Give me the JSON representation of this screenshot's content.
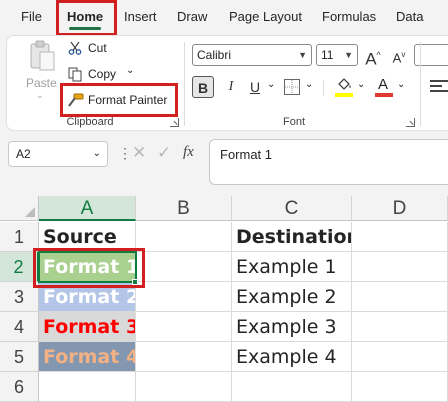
{
  "menu": {
    "tabs": [
      "File",
      "Home",
      "Insert",
      "Draw",
      "Page Layout",
      "Formulas",
      "Data"
    ],
    "active_tab": "Home"
  },
  "ribbon": {
    "clipboard": {
      "paste_label": "Paste",
      "cut_label": "Cut",
      "copy_label": "Copy",
      "format_painter_label": "Format Painter",
      "group_label": "Clipboard"
    },
    "font": {
      "font_name": "Calibri",
      "font_size": "11",
      "grow_label": "A",
      "shrink_label": "A",
      "bold_label": "B",
      "italic_label": "I",
      "underline_label": "U",
      "font_color_label": "A",
      "group_label": "Font",
      "fill_color": "#ffff00",
      "font_color": "#e03b2f"
    }
  },
  "formula_bar": {
    "cell_ref": "A2",
    "fx_label": "fx",
    "content": "Format 1"
  },
  "sheet": {
    "columns": [
      "A",
      "B",
      "C",
      "D"
    ],
    "rows": [
      "1",
      "2",
      "3",
      "4",
      "5",
      "6"
    ],
    "selected_cell": "A2",
    "cells": {
      "A1": "Source",
      "C1": "Destination",
      "A2": "Format 1",
      "C2": "Example 1",
      "A3": "Format 2",
      "C3": "Example 2",
      "A4": "Format 3",
      "C4": "Example 3",
      "A5": "Format 4",
      "C5": "Example 4"
    },
    "styles": {
      "A2": {
        "fill": "#a9d08e",
        "color": "#ffffff"
      },
      "A3": {
        "fill": "#b4c6e7",
        "color": "#ffffff"
      },
      "A4": {
        "fill": "#d9d9d9",
        "color": "#ff0000"
      },
      "A5": {
        "fill": "#8497b0",
        "color": "#f4b183"
      }
    }
  }
}
